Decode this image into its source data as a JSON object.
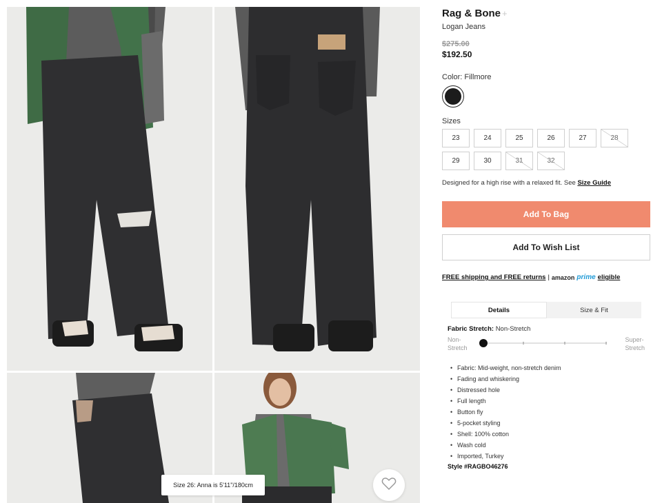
{
  "product": {
    "brand": "Rag & Bone",
    "brand_plus": "+",
    "name": "Logan Jeans",
    "price_original": "$275.00",
    "price_sale": "$192.50",
    "color_label": "Color: Fillmore",
    "color_swatch": "#1c1c1c"
  },
  "sizes": {
    "label": "Sizes",
    "options": [
      {
        "label": "23",
        "available": true
      },
      {
        "label": "24",
        "available": true
      },
      {
        "label": "25",
        "available": true
      },
      {
        "label": "26",
        "available": true
      },
      {
        "label": "27",
        "available": true
      },
      {
        "label": "28",
        "available": false
      },
      {
        "label": "29",
        "available": true
      },
      {
        "label": "30",
        "available": true
      },
      {
        "label": "31",
        "available": false
      },
      {
        "label": "32",
        "available": false
      }
    ],
    "fit_note": "Designed for a high rise with a relaxed fit.  See",
    "size_guide_link": "Size Guide"
  },
  "actions": {
    "add_to_bag": "Add To Bag",
    "add_to_wishlist": "Add To Wish List",
    "add_to_bag_color": "#f08a6e"
  },
  "shipping": {
    "text": "FREE shipping and FREE returns",
    "separator": "|",
    "amazon": "amazon",
    "prime": "prime",
    "eligible": "eligible"
  },
  "tabs": [
    {
      "label": "Details",
      "active": true
    },
    {
      "label": "Size & Fit",
      "active": false
    }
  ],
  "details": {
    "stretch_title": "Fabric Stretch:",
    "stretch_value": "Non-Stretch",
    "scale_left_1": "Non-",
    "scale_left_2": "Stretch",
    "scale_right_1": "Super-",
    "scale_right_2": "Stretch",
    "stretch_level": 0,
    "bullets": [
      "Fabric: Mid-weight, non-stretch denim",
      "Fading and whiskering",
      "Distressed hole",
      "Full length",
      "Button fly",
      "5-pocket styling",
      "Shell: 100% cotton",
      "Wash cold",
      "Imported, Turkey"
    ],
    "style_code": "Style #RAGBO46276"
  },
  "gallery": {
    "model_info": "Size 26: Anna is 5'11\"/180cm",
    "heart_icon": "heart-icon"
  }
}
